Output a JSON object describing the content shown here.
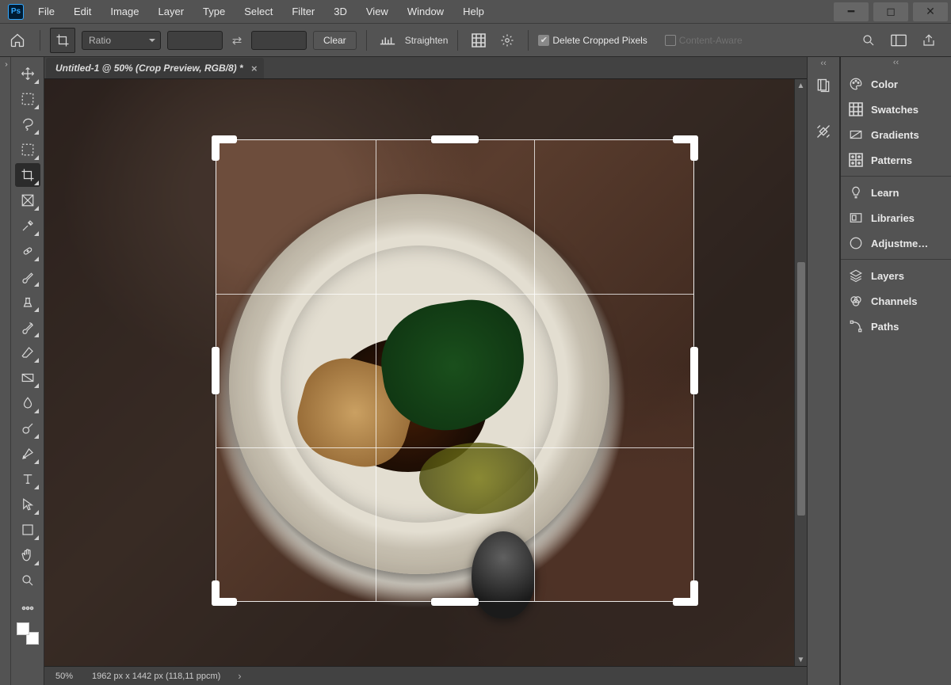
{
  "menu": [
    "File",
    "Edit",
    "Image",
    "Layer",
    "Type",
    "Select",
    "Filter",
    "3D",
    "View",
    "Window",
    "Help"
  ],
  "options": {
    "ratio_label": "Ratio",
    "clear": "Clear",
    "straighten": "Straighten",
    "delete_cropped": "Delete Cropped Pixels",
    "content_aware": "Content-Aware",
    "delete_cropped_checked": true,
    "content_aware_checked": false
  },
  "document": {
    "tab_title": "Untitled-1 @ 50% (Crop Preview, RGB/8) *"
  },
  "status": {
    "zoom": "50%",
    "dims": "1962 px x 1442 px (118,11 ppcm)"
  },
  "panels": {
    "group1": [
      "Color",
      "Swatches",
      "Gradients",
      "Patterns"
    ],
    "group2": [
      "Learn",
      "Libraries",
      "Adjustme…"
    ],
    "group3": [
      "Layers",
      "Channels",
      "Paths"
    ]
  },
  "tools": [
    {
      "id": "move",
      "active": false
    },
    {
      "id": "rect-marquee",
      "active": false
    },
    {
      "id": "lasso",
      "active": false
    },
    {
      "id": "quick-select",
      "active": false
    },
    {
      "id": "crop",
      "active": true
    },
    {
      "id": "frame",
      "active": false
    },
    {
      "id": "eyedropper",
      "active": false
    },
    {
      "id": "healing",
      "active": false
    },
    {
      "id": "brush",
      "active": false
    },
    {
      "id": "clone",
      "active": false
    },
    {
      "id": "history-brush",
      "active": false
    },
    {
      "id": "eraser",
      "active": false
    },
    {
      "id": "gradient",
      "active": false
    },
    {
      "id": "blur",
      "active": false
    },
    {
      "id": "dodge",
      "active": false
    },
    {
      "id": "pen",
      "active": false
    },
    {
      "id": "type",
      "active": false
    },
    {
      "id": "path-select",
      "active": false
    },
    {
      "id": "rectangle",
      "active": false
    },
    {
      "id": "hand",
      "active": false
    },
    {
      "id": "zoom",
      "active": false
    }
  ]
}
